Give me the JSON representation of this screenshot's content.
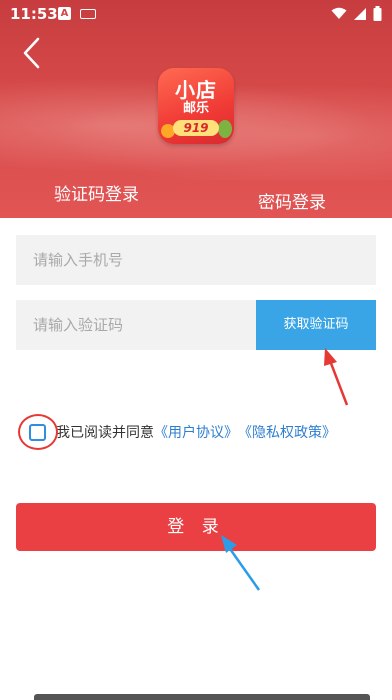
{
  "status_bar": {
    "time": "11:53",
    "icons": [
      "a-icon",
      "keyboard-icon",
      "wifi-icon",
      "signal-icon",
      "battery-icon"
    ]
  },
  "header": {
    "back_icon": "chevron-left-icon",
    "logo": {
      "line1": "小店",
      "line2": "邮乐",
      "badge": "919"
    }
  },
  "tabs": [
    {
      "label": "验证码登录",
      "active": true
    },
    {
      "label": "密码登录",
      "active": false
    }
  ],
  "form": {
    "phone_placeholder": "请输入手机号",
    "code_placeholder": "请输入验证码",
    "get_code_label": "获取验证码"
  },
  "agreement": {
    "checked": false,
    "text": "我已阅读并同意",
    "user_agreement": "《用户协议》",
    "privacy_policy": "《隐私权政策》"
  },
  "login_label": "登 录",
  "colors": {
    "header_red": "#d74a4a",
    "login_red": "#ea4043",
    "get_code_blue": "#3aa5e6",
    "link_blue": "#2f7fd0",
    "annotation_red": "#e53935",
    "annotation_blue": "#2b9de8"
  }
}
